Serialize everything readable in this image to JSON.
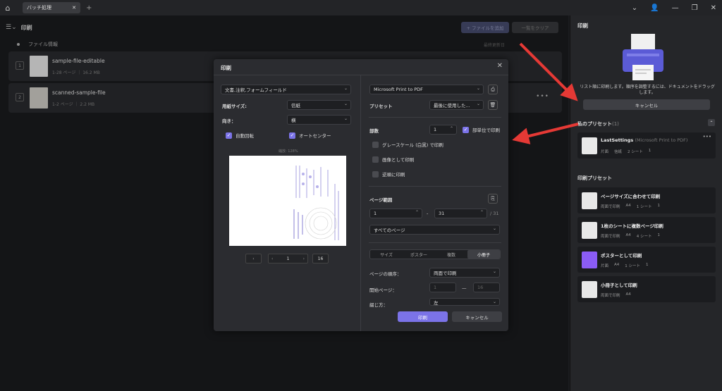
{
  "titlebar": {
    "tab_label": "バッチ処理",
    "tab_close": "✕",
    "new_tab": "+",
    "icons": [
      "home-icon",
      "chevron-down-icon",
      "user-icon",
      "restore-icon",
      "close-icon"
    ]
  },
  "toolbar": {
    "title": "印刷",
    "add_file": "+ ファイルを追加",
    "clear_list": "一覧をクリア"
  },
  "list": {
    "header": "ファイル情報",
    "header_right": "最終更新日",
    "rows": [
      {
        "num": "1",
        "name": "sample-file-editable",
        "meta": "1-28 ページ ｜ 16.2 MB"
      },
      {
        "num": "2",
        "name": "scanned-sample-file",
        "meta": "1-2 ページ ｜ 2.2 MB"
      }
    ]
  },
  "dialog": {
    "title": "印刷",
    "doc_mode": "文書,注釈,フォームフィールド",
    "paper_size_label": "用紙サイズ:",
    "paper_size": "信紙",
    "orientation_label": "向き：",
    "orientation": "横",
    "auto_rotate": "自動回転",
    "auto_center": "オートセンター",
    "scale_label": "縮放: 128%",
    "page_current": "1",
    "page_total": "16",
    "printer": "Microsoft Print to PDF",
    "preset_label": "プリセット",
    "preset_value": "最後に使用した...",
    "copies_label": "部数",
    "copies": "1",
    "collate": "部単位で印刷",
    "grayscale": "グレースケール (白黒) で印刷",
    "as_image": "画像として印刷",
    "reverse": "逆順に印刷",
    "range_label": "ページ範囲",
    "range_from": "1",
    "range_sep": "-",
    "range_to": "31",
    "range_total": "/ 31",
    "range_mode": "すべてのページ",
    "tabs": [
      "サイズ",
      "ポスター",
      "複数",
      "小冊子"
    ],
    "page_order_label": "ページの順序：",
    "page_order": "両面で印刷",
    "start_page_label": "開始ページ：",
    "start_page": "1",
    "start_sep": "—",
    "end_page": "16",
    "binding_label": "綴じ方：",
    "binding": "左",
    "print_btn": "印刷",
    "cancel_btn": "キャンセル"
  },
  "right": {
    "title": "印刷",
    "desc": "リスト順に印刷します。順序を調整するには、ドキュメントをドラッグします。",
    "cancel": "キャンセル",
    "my_presets_label": "私のプリセット",
    "my_presets_count": "(1)",
    "my_preset": {
      "name": "LastSettings",
      "sub": "(Microsoft Print to PDF)",
      "meta": [
        "片面",
        "信紙",
        "2 シート",
        "1"
      ]
    },
    "print_presets_label": "印刷プリセット",
    "presets": [
      {
        "name": "ページサイズに合わせて印刷",
        "meta": [
          "両面で印刷",
          "A4",
          "1 シート",
          "1"
        ]
      },
      {
        "name": "1枚のシートに複数ページ印刷",
        "meta": [
          "両面で印刷",
          "A4",
          "4 シート",
          "1"
        ]
      },
      {
        "name": "ポスターとして印刷",
        "meta": [
          "片面",
          "A4",
          "1 シート",
          "1"
        ]
      },
      {
        "name": "小冊子として印刷",
        "meta": [
          "両面で印刷",
          "A4",
          "",
          ""
        ]
      }
    ]
  },
  "colors": {
    "accent": "#7b73e8",
    "arrow": "#e53935",
    "printer": "#5b5bd6"
  }
}
